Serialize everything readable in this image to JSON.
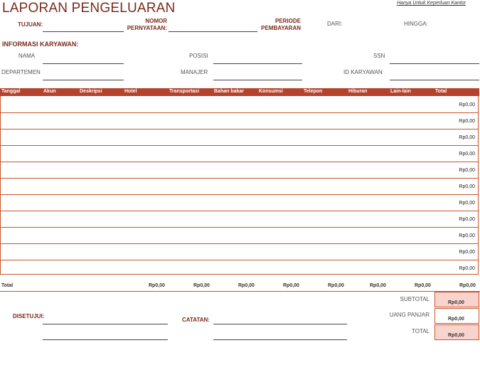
{
  "header": {
    "title": "LAPORAN PENGELUARAN",
    "office_note": "Hanya Untuk Keperluan Kantor"
  },
  "top_fields": {
    "tujuan": "TUJUAN:",
    "nomor_line1": "NOMOR",
    "nomor_line2": "PERNYATAAN:",
    "periode_line1": "PERIODE",
    "periode_line2": "PEMBAYARAN",
    "dari": "DARI:",
    "hingga": "HINGGA:"
  },
  "employee": {
    "section_title": "INFORMASI KARYAWAN:",
    "nama": "NAMA",
    "posisi": "POSISI",
    "ssn": "SSN",
    "departemen": "DEPARTEMEN",
    "manajer": "MANAJER",
    "id_karyawan": "ID KARYAWAN"
  },
  "table": {
    "headers": [
      "Tanggal",
      "Akun",
      "Deskripsi",
      "Hotel",
      "Transportasi",
      "Bahan bakar",
      "Konsumsi",
      "Telepon",
      "Hiburan",
      "Lain-lain",
      "Total"
    ],
    "row_totals": [
      "Rp0,00",
      "Rp0,00",
      "Rp0,00",
      "Rp0,00",
      "Rp0,00",
      "Rp0,00",
      "Rp0,00",
      "Rp0,00",
      "Rp0,00",
      "Rp0,00",
      "Rp0,00"
    ],
    "total_label": "Total",
    "column_totals": [
      "Rp0,00",
      "Rp0,00",
      "Rp0,00",
      "Rp0,00",
      "Rp0,00",
      "Rp0,00",
      "Rp0,00",
      "Rp0,00"
    ]
  },
  "footer": {
    "disetujui": "DISETUJUI:",
    "catatan": "CATATAN:",
    "subtotal_label": "SUBTOTAL",
    "subtotal_value": "Rp0,00",
    "uang_panjar_label": "UANG PANJAR",
    "uang_panjar_value": "Rp0,00",
    "total_label": "TOTAL",
    "total_value": "Rp0,00"
  },
  "colors": {
    "accent": "#b5432c",
    "title": "#7a2a1c",
    "highlight": "#f9d4cc"
  }
}
